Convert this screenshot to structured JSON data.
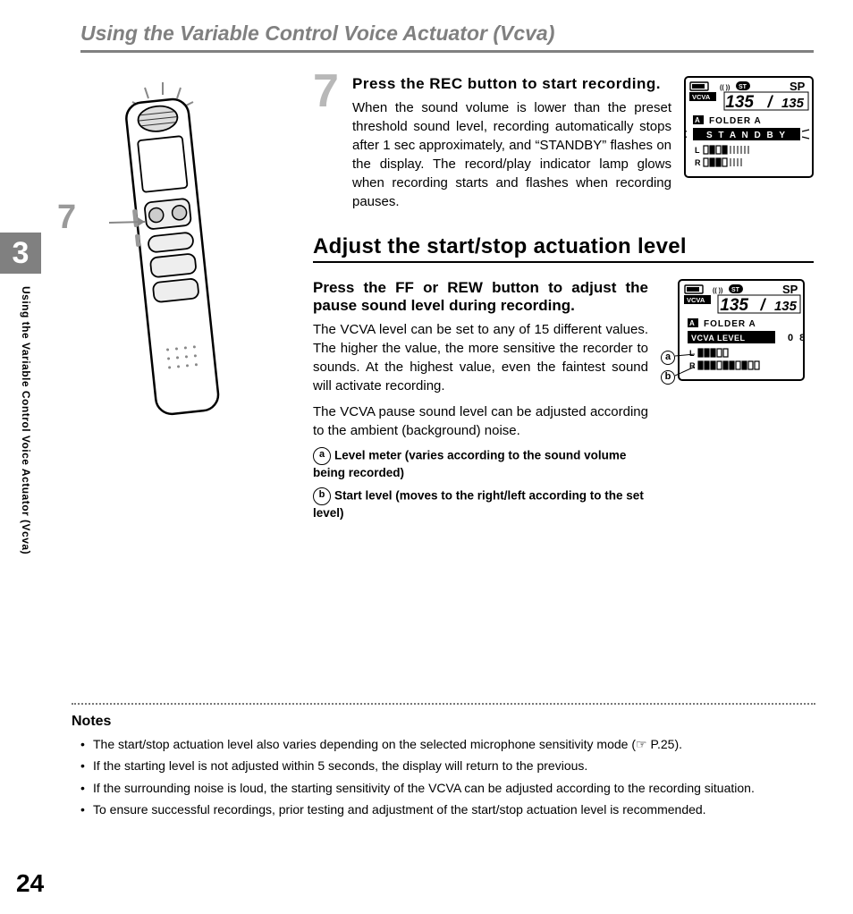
{
  "header": {
    "title": "Using the Variable Control Voice Actuator (Vcva)"
  },
  "chapter": {
    "number": "3",
    "side_label": "Using the Variable Control Voice Actuator (Vcva)"
  },
  "page_number": "24",
  "device_callout": "7",
  "step7": {
    "number": "7",
    "head_pre": "Press the ",
    "head_btn": "REC",
    "head_post": " button to start recording.",
    "body": "When the sound volume is lower than the preset threshold sound level, recording automatically stops after 1 sec approximately,  and “STANDBY” flashes on the display. The record/play indicator lamp glows when recording starts and flashes when recording pauses."
  },
  "subsection": {
    "title": "Adjust the start/stop actuation level"
  },
  "adjust": {
    "head_pre": "Press the ",
    "head_btn1": "FF",
    "head_mid": " or ",
    "head_btn2": "REW",
    "head_post": " button to adjust the pause sound level during recording.",
    "body1": "The VCVA level can be set to any of 15 different values. The higher the value, the more sensitive the recorder to sounds. At the highest value, even the faintest sound will activate recording.",
    "body2": "The VCVA pause sound level can be adjusted according to the ambient (background) noise.",
    "legend_a_label": "a",
    "legend_a_text": "Level meter (varies according to the sound volume being recorded)",
    "legend_b_label": "b",
    "legend_b_text": "Start level (moves to the right/left according to the set level)"
  },
  "lcd1": {
    "mode": "SP",
    "vcva": "VCVA",
    "st": "ST",
    "count_cur": "135",
    "count_total": "135",
    "folder_icon": "A",
    "folder": "FOLDER  A",
    "status": "S T A N D B Y",
    "L": "L",
    "R": "R"
  },
  "lcd2": {
    "mode": "SP",
    "vcva": "VCVA",
    "st": "ST",
    "count_cur": "135",
    "count_total": "135",
    "folder_icon": "A",
    "folder": "FOLDER  A",
    "bar_label": "VCVA LEVEL",
    "bar_value": "0 8",
    "L": "L",
    "R": "R",
    "callout_a": "a",
    "callout_b": "b"
  },
  "notes": {
    "title": "Notes",
    "items": [
      "The start/stop actuation level also varies depending on the selected microphone sensitivity mode (☞ P.25).",
      "If the starting level is not adjusted within 5 seconds, the display will return to the previous.",
      "If the surrounding noise is loud, the starting sensitivity of the VCVA can be adjusted according to the recording situation.",
      "To ensure successful recordings, prior testing and adjustment of the start/stop actuation level is recommended."
    ]
  }
}
